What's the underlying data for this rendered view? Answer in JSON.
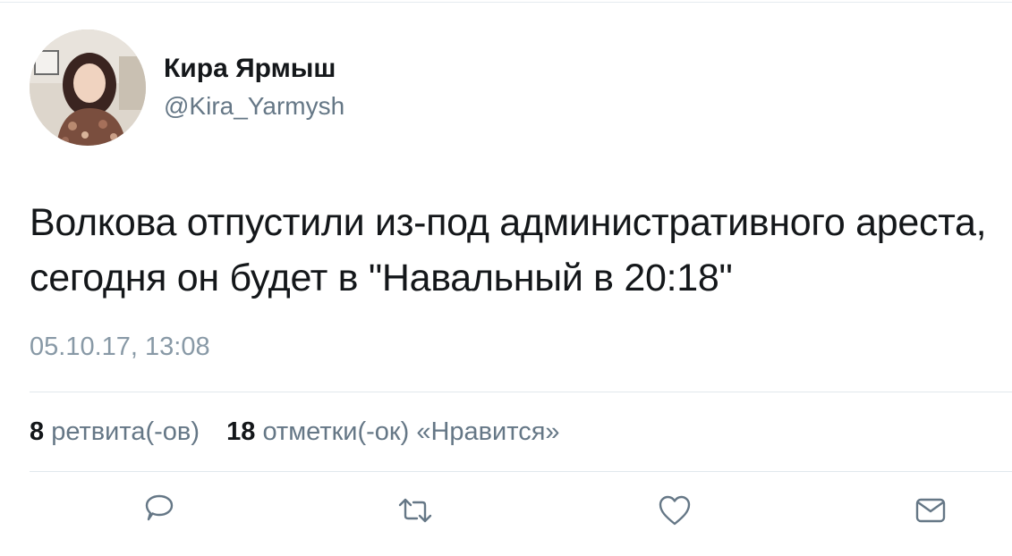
{
  "author": {
    "name": "Кира Ярмыш",
    "handle": "@Kira_Yarmysh"
  },
  "tweet": {
    "text": "Волкова отпустили из-под административного ареста, сегодня он будет в \"Навальный в 20:18\"",
    "timestamp": "05.10.17, 13:08"
  },
  "stats": {
    "retweets_count": "8",
    "retweets_label": "ретвита(-ов)",
    "likes_count": "18",
    "likes_label": "отметки(-ок) «Нравится»"
  },
  "actions": {
    "icons": [
      "reply-icon",
      "retweet-icon",
      "like-icon",
      "message-icon"
    ]
  },
  "colors": {
    "text": "#14171a",
    "secondary": "#657786",
    "muted": "#8899a6",
    "icon": "#657786",
    "divider": "#e1e8ed"
  }
}
